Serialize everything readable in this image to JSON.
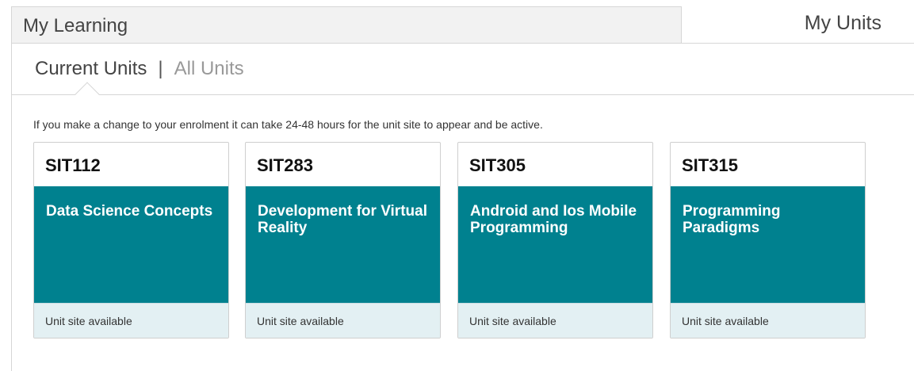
{
  "header": {
    "title": "My Learning"
  },
  "panel": {
    "title": "My Units"
  },
  "tabs": {
    "current": "Current Units",
    "separator": "|",
    "all": "All Units"
  },
  "notice": "If you make a change to your enrolment it can take 24-48 hours for the unit site to appear and be active.",
  "units": [
    {
      "code": "SIT112",
      "name": "Data Science Concepts",
      "status": "Unit site available"
    },
    {
      "code": "SIT283",
      "name": "Development for Virtual Reality",
      "status": "Unit site available"
    },
    {
      "code": "SIT305",
      "name": "Android and Ios Mobile Programming",
      "status": "Unit site available"
    },
    {
      "code": "SIT315",
      "name": "Programming Paradigms",
      "status": "Unit site available"
    }
  ],
  "colors": {
    "card_accent": "#00818f",
    "card_footer": "#e3f0f3"
  }
}
